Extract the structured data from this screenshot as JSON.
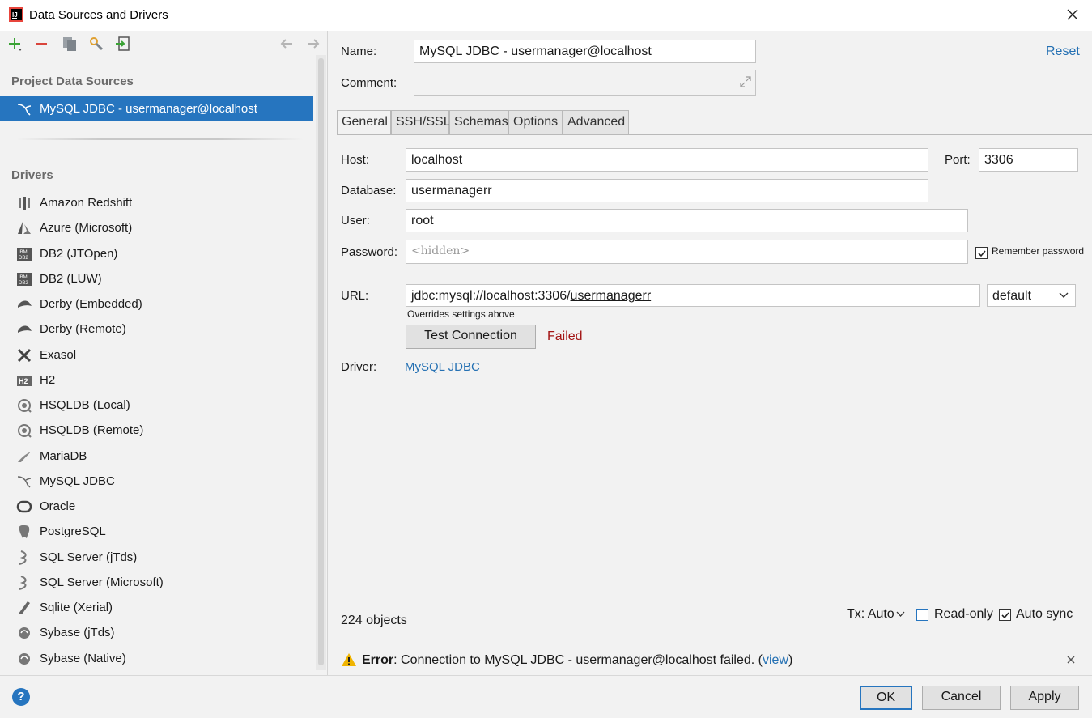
{
  "window": {
    "title": "Data Sources and Drivers"
  },
  "sidebar": {
    "project_header": "Project Data Sources",
    "selected_source": "MySQL JDBC - usermanager@localhost",
    "drivers_header": "Drivers",
    "drivers": [
      {
        "label": "Amazon Redshift",
        "icon": "redshift-icon"
      },
      {
        "label": "Azure (Microsoft)",
        "icon": "azure-icon"
      },
      {
        "label": "DB2 (JTOpen)",
        "icon": "db2-icon"
      },
      {
        "label": "DB2 (LUW)",
        "icon": "db2-icon"
      },
      {
        "label": "Derby (Embedded)",
        "icon": "derby-icon"
      },
      {
        "label": "Derby (Remote)",
        "icon": "derby-icon"
      },
      {
        "label": "Exasol",
        "icon": "exasol-icon"
      },
      {
        "label": "H2",
        "icon": "h2-icon"
      },
      {
        "label": "HSQLDB (Local)",
        "icon": "hsqldb-icon"
      },
      {
        "label": "HSQLDB (Remote)",
        "icon": "hsqldb-icon"
      },
      {
        "label": "MariaDB",
        "icon": "mariadb-icon"
      },
      {
        "label": "MySQL JDBC",
        "icon": "mysql-icon"
      },
      {
        "label": "Oracle",
        "icon": "oracle-icon"
      },
      {
        "label": "PostgreSQL",
        "icon": "postgresql-icon"
      },
      {
        "label": "SQL Server (jTds)",
        "icon": "sqlserver-icon"
      },
      {
        "label": "SQL Server (Microsoft)",
        "icon": "sqlserver-icon"
      },
      {
        "label": "Sqlite (Xerial)",
        "icon": "sqlite-icon"
      },
      {
        "label": "Sybase (jTds)",
        "icon": "sybase-icon"
      },
      {
        "label": "Sybase (Native)",
        "icon": "sybase-icon"
      }
    ]
  },
  "form": {
    "name_label": "Name:",
    "name_value": "MySQL JDBC - usermanager@localhost",
    "reset": "Reset",
    "comment_label": "Comment:",
    "comment_value": "",
    "tabs": [
      "General",
      "SSH/SSL",
      "Schemas",
      "Options",
      "Advanced"
    ],
    "host_label": "Host:",
    "host_value": "localhost",
    "port_label": "Port:",
    "port_value": "3306",
    "database_label": "Database:",
    "database_value": "usermanagerr",
    "user_label": "User:",
    "user_value": "root",
    "password_label": "Password:",
    "password_placeholder": "<hidden>",
    "remember_password": "Remember password",
    "url_label": "URL:",
    "url_prefix": "jdbc:mysql://localhost:3306/",
    "url_db": "usermanagerr",
    "url_mode": "default",
    "url_hint": "Overrides settings above",
    "test_connection": "Test Connection",
    "test_status": "Failed",
    "driver_label": "Driver:",
    "driver_value": "MySQL JDBC",
    "objects_count": "224 objects",
    "tx_label": "Tx: Auto",
    "readonly_label": "Read-only",
    "autosync_label": "Auto sync"
  },
  "error": {
    "title": "Error",
    "message_before": ": Connection to MySQL JDBC - usermanager@localhost failed. (",
    "link": "view",
    "message_after": ")"
  },
  "buttons": {
    "ok": "OK",
    "cancel": "Cancel",
    "apply": "Apply"
  },
  "colors": {
    "accent": "#2675bf",
    "failed": "#a31515",
    "link": "#2470b3"
  }
}
